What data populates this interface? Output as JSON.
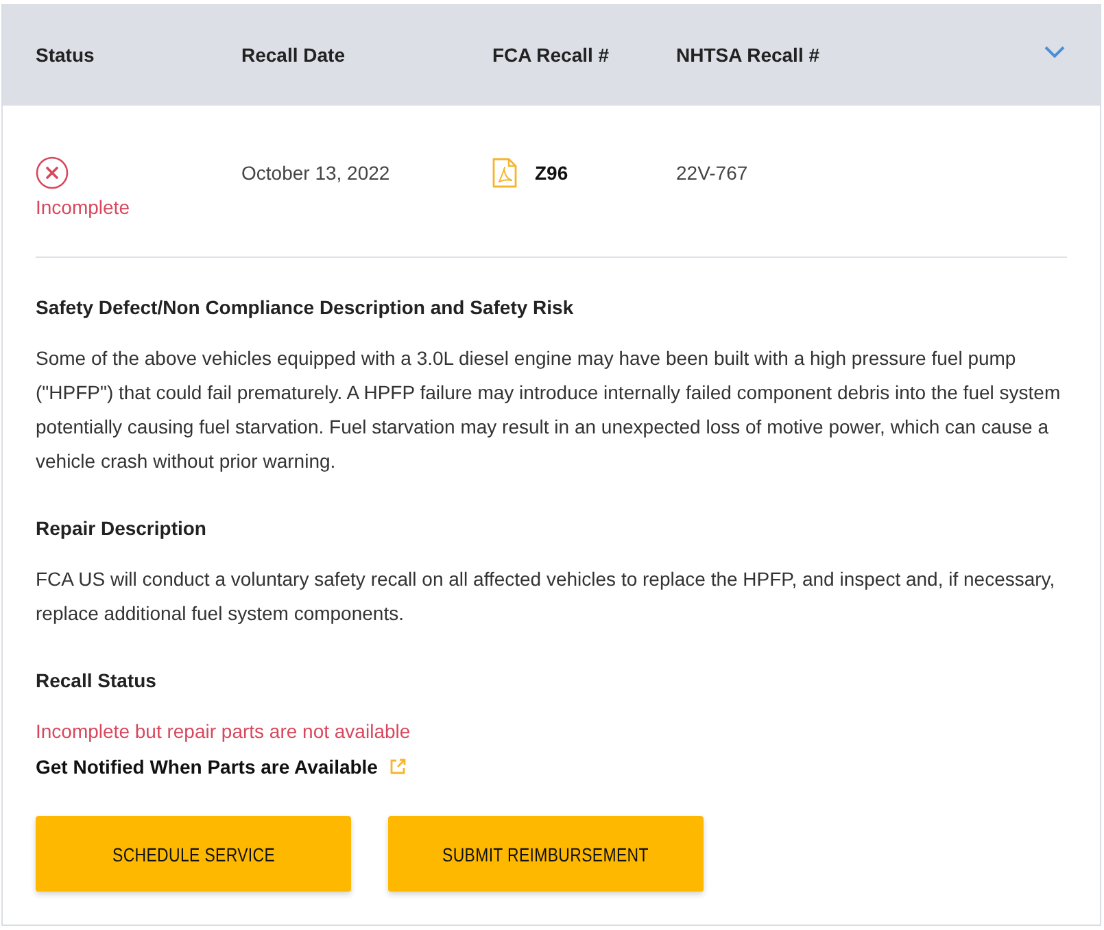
{
  "table": {
    "columns": [
      "Status",
      "Recall Date",
      "FCA Recall #",
      "NHTSA Recall #"
    ],
    "expanded": true,
    "row": {
      "status": {
        "kind": "incomplete",
        "label": "Incomplete"
      },
      "recall_date": "October 13, 2022",
      "fca_recall": "Z96",
      "nhtsa_recall": "22V-767"
    }
  },
  "sections": [
    {
      "heading": "Safety Defect/Non Compliance Description and Safety Risk",
      "text": "Some of the above vehicles equipped with a 3.0L diesel engine may have been built with a high pressure fuel pump (\"HPFP\") that could fail prematurely. A HPFP failure may introduce internally failed component debris into the fuel system potentially causing fuel starvation. Fuel starvation may result in an unexpected loss of motive power, which can cause a vehicle crash without prior warning."
    },
    {
      "heading": "Repair Description",
      "text": "FCA US will conduct a voluntary safety recall on all affected vehicles to replace the HPFP, and inspect and, if necessary, replace additional fuel system components."
    }
  ],
  "recall_status": {
    "heading": "Recall Status",
    "status_text": "Incomplete but repair parts are not available",
    "notify_link": "Get Notified When Parts are Available"
  },
  "buttons": [
    "SCHEDULE SERVICE",
    "SUBMIT REIMBURSEMENT"
  ]
}
